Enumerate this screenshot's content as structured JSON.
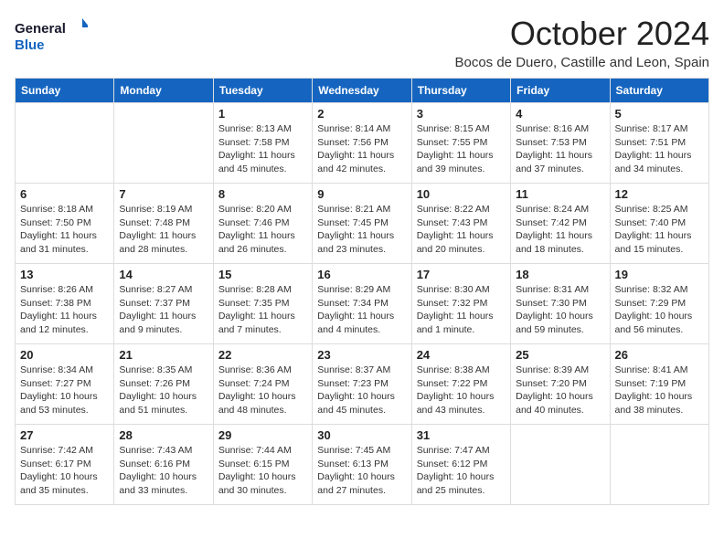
{
  "header": {
    "logo_general": "General",
    "logo_blue": "Blue",
    "month_title": "October 2024",
    "location": "Bocos de Duero, Castille and Leon, Spain"
  },
  "days_of_week": [
    "Sunday",
    "Monday",
    "Tuesday",
    "Wednesday",
    "Thursday",
    "Friday",
    "Saturday"
  ],
  "weeks": [
    [
      {
        "date": "",
        "info": ""
      },
      {
        "date": "",
        "info": ""
      },
      {
        "date": "1",
        "info": "Sunrise: 8:13 AM\nSunset: 7:58 PM\nDaylight: 11 hours and 45 minutes."
      },
      {
        "date": "2",
        "info": "Sunrise: 8:14 AM\nSunset: 7:56 PM\nDaylight: 11 hours and 42 minutes."
      },
      {
        "date": "3",
        "info": "Sunrise: 8:15 AM\nSunset: 7:55 PM\nDaylight: 11 hours and 39 minutes."
      },
      {
        "date": "4",
        "info": "Sunrise: 8:16 AM\nSunset: 7:53 PM\nDaylight: 11 hours and 37 minutes."
      },
      {
        "date": "5",
        "info": "Sunrise: 8:17 AM\nSunset: 7:51 PM\nDaylight: 11 hours and 34 minutes."
      }
    ],
    [
      {
        "date": "6",
        "info": "Sunrise: 8:18 AM\nSunset: 7:50 PM\nDaylight: 11 hours and 31 minutes."
      },
      {
        "date": "7",
        "info": "Sunrise: 8:19 AM\nSunset: 7:48 PM\nDaylight: 11 hours and 28 minutes."
      },
      {
        "date": "8",
        "info": "Sunrise: 8:20 AM\nSunset: 7:46 PM\nDaylight: 11 hours and 26 minutes."
      },
      {
        "date": "9",
        "info": "Sunrise: 8:21 AM\nSunset: 7:45 PM\nDaylight: 11 hours and 23 minutes."
      },
      {
        "date": "10",
        "info": "Sunrise: 8:22 AM\nSunset: 7:43 PM\nDaylight: 11 hours and 20 minutes."
      },
      {
        "date": "11",
        "info": "Sunrise: 8:24 AM\nSunset: 7:42 PM\nDaylight: 11 hours and 18 minutes."
      },
      {
        "date": "12",
        "info": "Sunrise: 8:25 AM\nSunset: 7:40 PM\nDaylight: 11 hours and 15 minutes."
      }
    ],
    [
      {
        "date": "13",
        "info": "Sunrise: 8:26 AM\nSunset: 7:38 PM\nDaylight: 11 hours and 12 minutes."
      },
      {
        "date": "14",
        "info": "Sunrise: 8:27 AM\nSunset: 7:37 PM\nDaylight: 11 hours and 9 minutes."
      },
      {
        "date": "15",
        "info": "Sunrise: 8:28 AM\nSunset: 7:35 PM\nDaylight: 11 hours and 7 minutes."
      },
      {
        "date": "16",
        "info": "Sunrise: 8:29 AM\nSunset: 7:34 PM\nDaylight: 11 hours and 4 minutes."
      },
      {
        "date": "17",
        "info": "Sunrise: 8:30 AM\nSunset: 7:32 PM\nDaylight: 11 hours and 1 minute."
      },
      {
        "date": "18",
        "info": "Sunrise: 8:31 AM\nSunset: 7:30 PM\nDaylight: 10 hours and 59 minutes."
      },
      {
        "date": "19",
        "info": "Sunrise: 8:32 AM\nSunset: 7:29 PM\nDaylight: 10 hours and 56 minutes."
      }
    ],
    [
      {
        "date": "20",
        "info": "Sunrise: 8:34 AM\nSunset: 7:27 PM\nDaylight: 10 hours and 53 minutes."
      },
      {
        "date": "21",
        "info": "Sunrise: 8:35 AM\nSunset: 7:26 PM\nDaylight: 10 hours and 51 minutes."
      },
      {
        "date": "22",
        "info": "Sunrise: 8:36 AM\nSunset: 7:24 PM\nDaylight: 10 hours and 48 minutes."
      },
      {
        "date": "23",
        "info": "Sunrise: 8:37 AM\nSunset: 7:23 PM\nDaylight: 10 hours and 45 minutes."
      },
      {
        "date": "24",
        "info": "Sunrise: 8:38 AM\nSunset: 7:22 PM\nDaylight: 10 hours and 43 minutes."
      },
      {
        "date": "25",
        "info": "Sunrise: 8:39 AM\nSunset: 7:20 PM\nDaylight: 10 hours and 40 minutes."
      },
      {
        "date": "26",
        "info": "Sunrise: 8:41 AM\nSunset: 7:19 PM\nDaylight: 10 hours and 38 minutes."
      }
    ],
    [
      {
        "date": "27",
        "info": "Sunrise: 7:42 AM\nSunset: 6:17 PM\nDaylight: 10 hours and 35 minutes."
      },
      {
        "date": "28",
        "info": "Sunrise: 7:43 AM\nSunset: 6:16 PM\nDaylight: 10 hours and 33 minutes."
      },
      {
        "date": "29",
        "info": "Sunrise: 7:44 AM\nSunset: 6:15 PM\nDaylight: 10 hours and 30 minutes."
      },
      {
        "date": "30",
        "info": "Sunrise: 7:45 AM\nSunset: 6:13 PM\nDaylight: 10 hours and 27 minutes."
      },
      {
        "date": "31",
        "info": "Sunrise: 7:47 AM\nSunset: 6:12 PM\nDaylight: 10 hours and 25 minutes."
      },
      {
        "date": "",
        "info": ""
      },
      {
        "date": "",
        "info": ""
      }
    ]
  ]
}
